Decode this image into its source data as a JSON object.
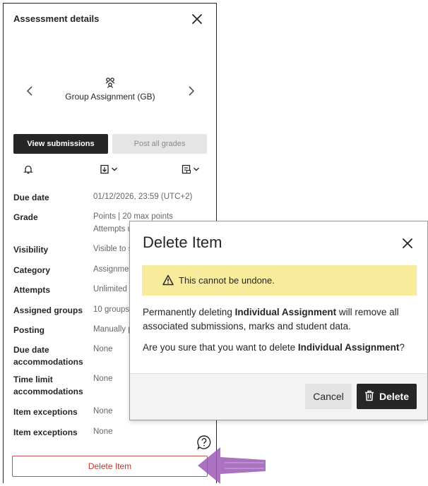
{
  "panel": {
    "title": "Assessment details",
    "group_name": "Group Assignment (GB)",
    "view_submissions_label": "View submissions",
    "post_all_grades_label": "Post all grades",
    "details": [
      {
        "label": "Due date",
        "value": "01/12/2026, 23:59 (UTC+2)"
      },
      {
        "label": "Grade",
        "value": "Points | 20 max points",
        "value2": "Attempts u"
      },
      {
        "label": "Visibility",
        "value": "Visible to s"
      },
      {
        "label": "Category",
        "value": "Assignmen"
      },
      {
        "label": "Attempts",
        "value": "Unlimited"
      },
      {
        "label": "Assigned groups",
        "value": "10 groups"
      },
      {
        "label": "Posting",
        "value": "Manually p"
      },
      {
        "label": "Due date",
        "label2": "accommodations",
        "value": "None"
      },
      {
        "label": "Time limit",
        "label2": "accommodations",
        "value": "None"
      },
      {
        "label": "Item exceptions",
        "value": "None"
      },
      {
        "label": "Item exceptions",
        "value": "None"
      }
    ],
    "delete_item_label": "Delete Item"
  },
  "modal": {
    "title": "Delete Item",
    "warning": "This cannot be undone.",
    "body_prefix": "Permanently deleting ",
    "item_name": "Individual Assignment",
    "body_suffix": " will remove all associated submissions, marks and student data.",
    "confirm_prefix": "Are you sure that you want to delete ",
    "confirm_suffix": "?",
    "cancel_label": "Cancel",
    "delete_label": "Delete"
  },
  "colors": {
    "dark": "#262626",
    "warning_bg": "#f8ec9c",
    "danger": "#c0392b",
    "annotation_arrow": "#9b59b6"
  },
  "icons": [
    "close-icon",
    "chevron-left-icon",
    "chevron-right-icon",
    "group-icon",
    "bell-icon",
    "download-icon",
    "chevron-down-icon",
    "export-icon",
    "help-icon",
    "warning-icon",
    "trash-icon"
  ]
}
